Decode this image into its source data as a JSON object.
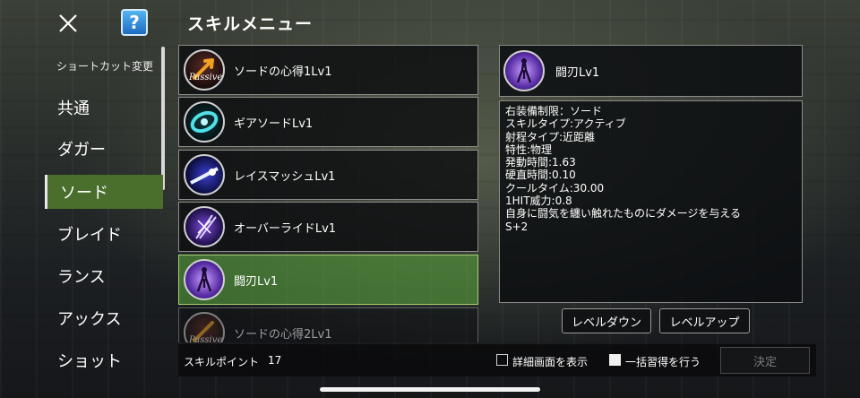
{
  "header": {
    "title": "スキルメニュー",
    "help_label": "?"
  },
  "sidebar": {
    "shortcut_label": "ショートカット変更",
    "items": [
      {
        "label": "共通",
        "active": false
      },
      {
        "label": "ダガー",
        "active": false
      },
      {
        "label": "ソード",
        "active": true
      },
      {
        "label": "ブレイド",
        "active": false
      },
      {
        "label": "ランス",
        "active": false
      },
      {
        "label": "アックス",
        "active": false
      },
      {
        "label": "ショット",
        "active": false
      }
    ]
  },
  "skills": [
    {
      "name": "ソードの心得1Lv1",
      "icon": "passive-icon",
      "icon_text": "Passive"
    },
    {
      "name": "ギアソードLv1",
      "icon": "gear-sword-icon"
    },
    {
      "name": "レイスマッシュLv1",
      "icon": "ray-smash-icon"
    },
    {
      "name": "オーバーライドLv1",
      "icon": "override-icon"
    },
    {
      "name": "闘刃Lv1",
      "icon": "touha-icon",
      "selected": true
    },
    {
      "name": "ソードの心得2Lv1",
      "icon": "passive-icon",
      "icon_text": "Passive"
    }
  ],
  "detail": {
    "name": "闘刃Lv1",
    "lines": [
      "右装備制限：ソード",
      "",
      "スキルタイプ:アクティブ",
      "射程タイプ:近距離",
      "特性:物理",
      "発動時間:1.63",
      "硬直時間:0.10",
      "クールタイム:30.00",
      "1HIT威力:0.8",
      "",
      "自身に闘気を纏い触れたものにダメージを与える",
      "",
      "S+2"
    ]
  },
  "buttons": {
    "level_down": "レベルダウン",
    "level_up": "レベルアップ",
    "decide": "決定"
  },
  "footer": {
    "points_label": "スキルポイント",
    "points_value": "17",
    "show_detail_label": "詳細画面を表示",
    "show_detail_checked": false,
    "bulk_learn_label": "一括習得を行う",
    "bulk_learn_checked": true
  }
}
